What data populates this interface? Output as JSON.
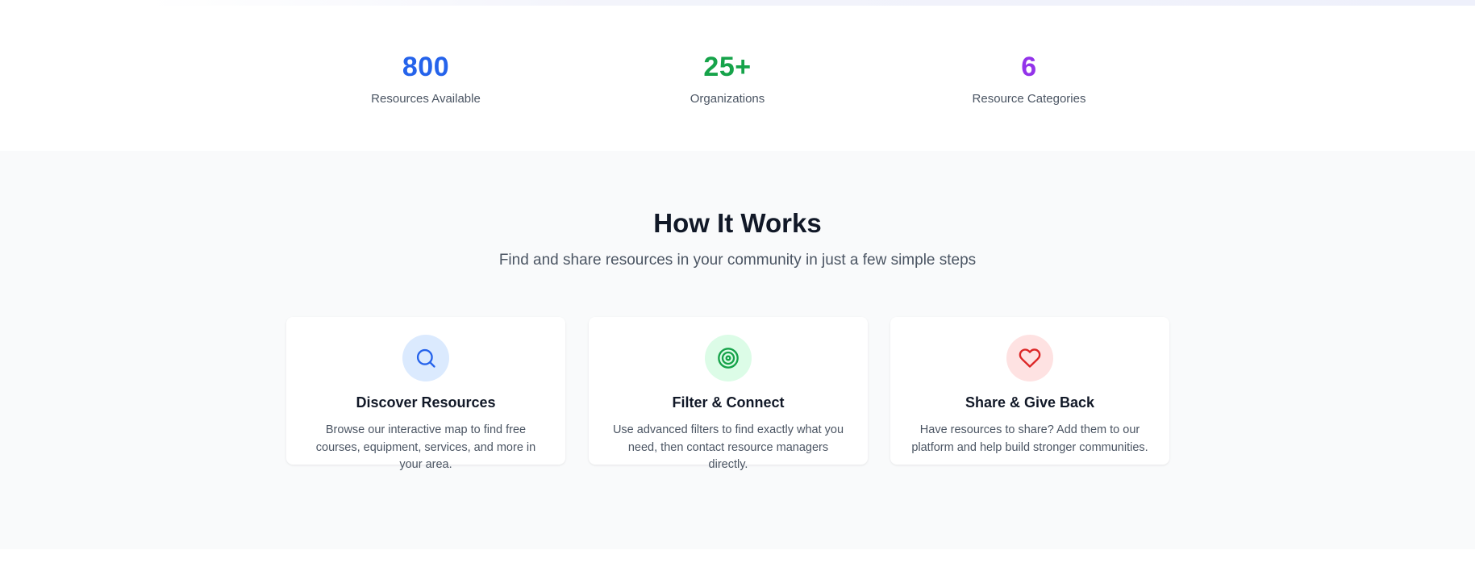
{
  "colors": {
    "blue": "#2563eb",
    "green": "#16a34a",
    "purple": "#9333ea",
    "red": "#dc2626",
    "blue_bg": "#dbeafe",
    "green_bg": "#dcfce7",
    "red_bg": "#fee2e2"
  },
  "stats": [
    {
      "value": "800",
      "label": "Resources Available",
      "color": "blue"
    },
    {
      "value": "25+",
      "label": "Organizations",
      "color": "green"
    },
    {
      "value": "6",
      "label": "Resource Categories",
      "color": "purple"
    }
  ],
  "how_it_works": {
    "title": "How It Works",
    "subtitle": "Find and share resources in your community in just a few simple steps",
    "cards": [
      {
        "icon": "search-icon",
        "title": "Discover Resources",
        "description": "Browse our interactive map to find free courses, equipment, services, and more in your area."
      },
      {
        "icon": "target-icon",
        "title": "Filter & Connect",
        "description": "Use advanced filters to find exactly what you need, then contact resource managers directly."
      },
      {
        "icon": "heart-icon",
        "title": "Share & Give Back",
        "description": "Have resources to share? Add them to our platform and help build stronger communities."
      }
    ]
  }
}
